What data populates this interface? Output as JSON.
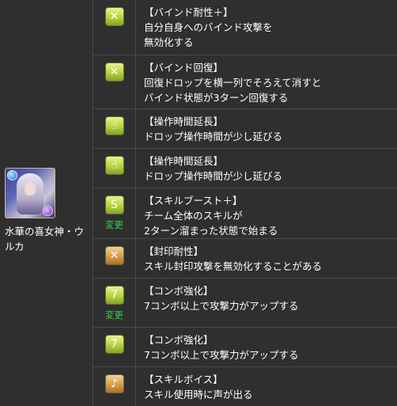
{
  "monster": {
    "name": "水華の喜女神・ウルカ",
    "main_attribute_color": "#1f6fd1",
    "sub_attribute_color": "#7a2bc7"
  },
  "changed_label": "変更",
  "awakenings": [
    {
      "icon": "bind-resist-plus-icon",
      "glyph": "✕",
      "title": "【バインド耐性＋】",
      "desc": "自分自身へのバインド攻撃を\n無効化する",
      "changed": false
    },
    {
      "icon": "bind-recovery-icon",
      "glyph": "✕",
      "title": "【バインド回復】",
      "desc": "回復ドロップを横一列でそろえて消すと\nバインド状態が3ターン回復する",
      "changed": false
    },
    {
      "icon": "time-extend-icon",
      "glyph": "☝",
      "title": "【操作時間延長】",
      "desc": "ドロップ操作時間が少し延びる",
      "changed": false
    },
    {
      "icon": "time-extend-icon",
      "glyph": "☝",
      "title": "【操作時間延長】",
      "desc": "ドロップ操作時間が少し延びる",
      "changed": false
    },
    {
      "icon": "skill-boost-plus-icon",
      "glyph": "S",
      "title": "【スキルブースト＋】",
      "desc": "チーム全体のスキルが\n2ターン溜まった状態で始まる",
      "changed": true
    },
    {
      "icon": "seal-resist-icon",
      "glyph": "✕",
      "title": "【封印耐性】",
      "desc": "スキル封印攻撃を無効化することがある",
      "changed": false
    },
    {
      "icon": "combo-enhance-icon",
      "glyph": "7",
      "title": "【コンボ強化】",
      "desc": "7コンボ以上で攻撃力がアップする",
      "changed": true
    },
    {
      "icon": "combo-enhance-icon",
      "glyph": "7",
      "title": "【コンボ強化】",
      "desc": "7コンボ以上で攻撃力がアップする",
      "changed": false
    },
    {
      "icon": "skill-voice-icon",
      "glyph": "♪",
      "title": "【スキルボイス】",
      "desc": "スキル使用時に声が出る",
      "changed": false
    }
  ]
}
